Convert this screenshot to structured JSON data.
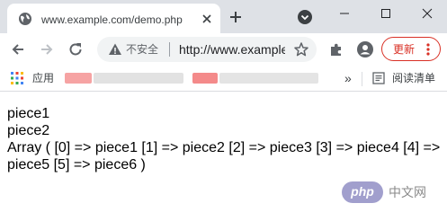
{
  "tab": {
    "title": "www.example.com/demo.php",
    "favicon": "globe-icon"
  },
  "toolbar": {
    "security_label": "不安全",
    "url": "http://www.example.com/demo.php",
    "update_label": "更新"
  },
  "bookmarks": {
    "apps_label": "应用",
    "more_label": "»",
    "reading_list_label": "阅读清单"
  },
  "content": {
    "lines": [
      "piece1",
      "piece2",
      "Array ( [0] => piece1 [1] => piece2 [2] => piece3 [3] => piece4 [4] => piece5 [5] => piece6 )"
    ]
  },
  "watermark": {
    "logo": "php",
    "text": "中文网"
  },
  "colors": {
    "tabstrip": "#dee1e6",
    "omnibox": "#f1f3f4",
    "update_accent": "#d93025"
  }
}
